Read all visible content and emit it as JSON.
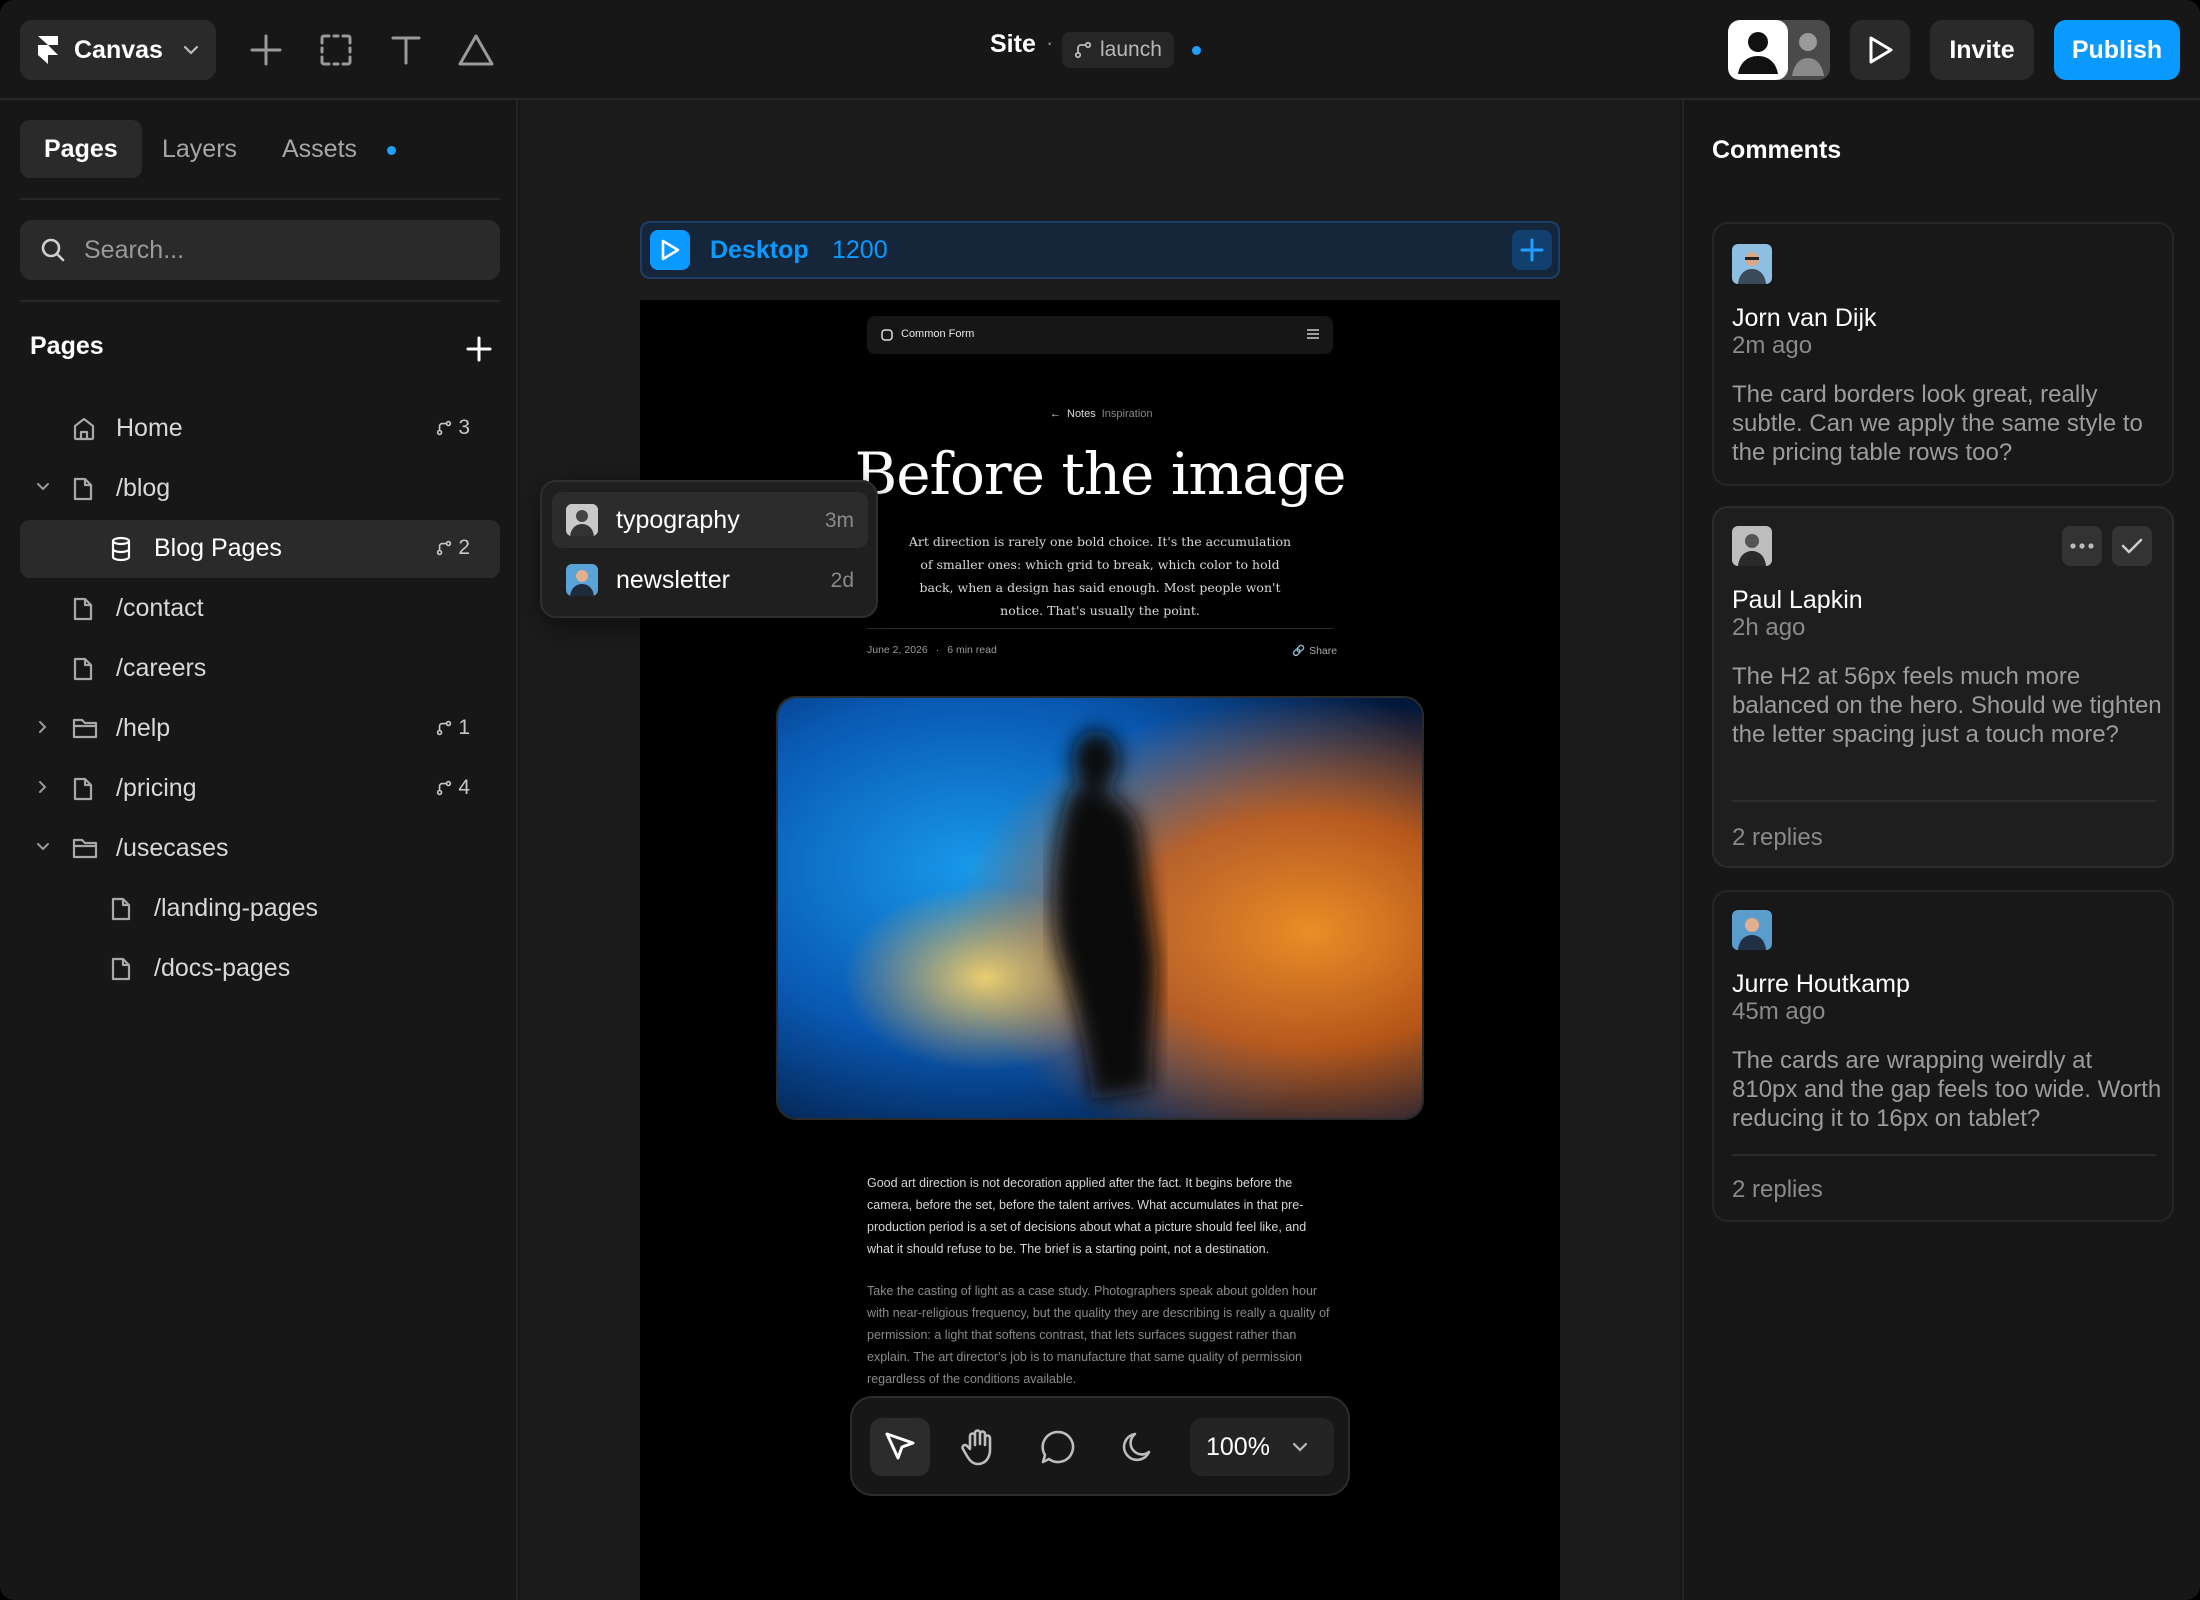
{
  "topbar": {
    "app_label": "Canvas",
    "site_title": "Site",
    "separator": "·",
    "branch": "launch",
    "invite_label": "Invite",
    "publish_label": "Publish"
  },
  "sidebar": {
    "tabs": [
      "Pages",
      "Layers",
      "Assets"
    ],
    "search_placeholder": "Search...",
    "pages_heading": "Pages",
    "items": [
      {
        "label": "Home",
        "count": "3"
      },
      {
        "label": "/blog",
        "count": ""
      },
      {
        "label": "Blog Pages",
        "count": "2"
      },
      {
        "label": "/contact",
        "count": ""
      },
      {
        "label": "/careers",
        "count": ""
      },
      {
        "label": "/help",
        "count": "1"
      },
      {
        "label": "/pricing",
        "count": "4"
      },
      {
        "label": "/usecases",
        "count": ""
      },
      {
        "label": "/landing-pages",
        "count": ""
      },
      {
        "label": "/docs-pages",
        "count": ""
      }
    ]
  },
  "canvas": {
    "breakpoint_name": "Desktop",
    "breakpoint_width": "1200",
    "popup": [
      {
        "label": "typography",
        "time": "3m"
      },
      {
        "label": "newsletter",
        "time": "2d"
      }
    ],
    "zoom": "100%"
  },
  "preview": {
    "nav_brand": "Common Form",
    "crumb_back": "Notes",
    "crumb_tag": "Inspiration",
    "title": "Before the image",
    "lede": "Art direction is rarely one bold choice. It's the accumulation of smaller ones: which grid to break, which color to hold back, when a design has said enough. Most people won't notice. That's usually the point.",
    "date": "June 2, 2026",
    "meta_sep": "·",
    "read_time": "6 min read",
    "share": "Share",
    "para1": "Good art direction is not decoration applied after the fact. It begins before the camera, before the set, before the talent arrives. What accumulates in that pre-production period is a set of decisions about what a picture should feel like, and what it should refuse to be. The brief is a starting point, not a destination.",
    "para2": "Take the casting of light as a case study. Photographers speak about golden hour with near-religious frequency, but the quality they are describing is really a quality of permission: a light that softens contrast, that lets surfaces suggest rather than explain. The art director's job is to manufacture that same quality of permission regardless of the conditions available."
  },
  "comments": {
    "heading": "Comments",
    "items": [
      {
        "name": "Jorn van Dijk",
        "time": "2m ago",
        "text": "The card borders look great, really subtle. Can we apply the same style to the pricing table rows too?",
        "replies": ""
      },
      {
        "name": "Paul Lapkin",
        "time": "2h ago",
        "text": "The H2 at 56px feels much more balanced on the hero. Should we tighten the letter spacing just a touch more?",
        "replies": "2 replies"
      },
      {
        "name": "Jurre Houtkamp",
        "time": "45m ago",
        "text": "The cards are wrapping weirdly at 810px and the gap feels too wide. Worth reducing it to 16px on tablet?",
        "replies": "2 replies"
      }
    ]
  },
  "colors": {
    "accent": "#0a99ff",
    "background": "#161616",
    "panel": "#171717",
    "canvas": "#1c1c1c"
  }
}
